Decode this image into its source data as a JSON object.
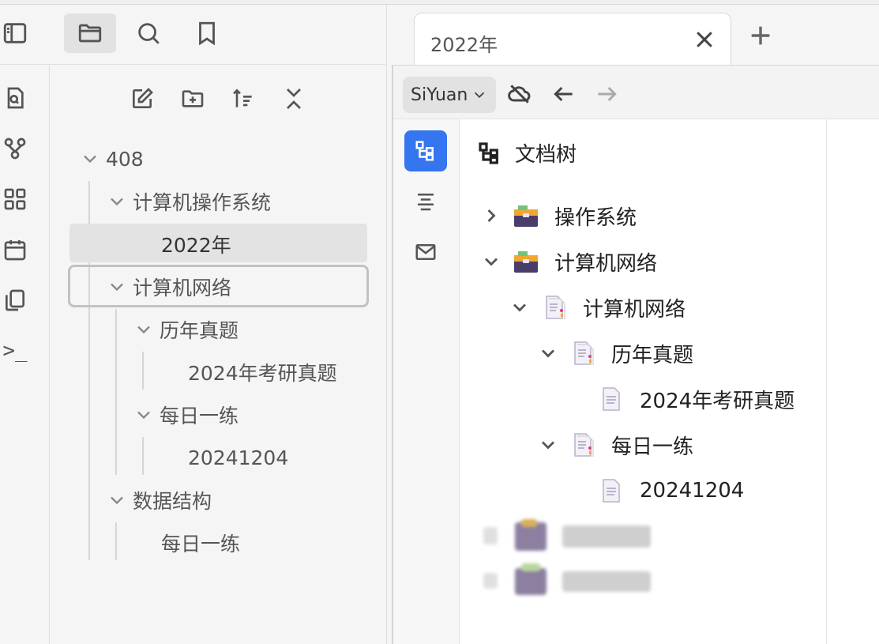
{
  "left_toolbar": {
    "icons": [
      "sidebar-toggle-icon",
      "folder-icon",
      "search-icon",
      "bookmark-icon"
    ]
  },
  "side_rail": {
    "icons": [
      "search-doc-icon",
      "graph-icon",
      "apps-icon",
      "calendar-icon",
      "copy-icon",
      "terminal-icon"
    ],
    "terminal_text": ">_"
  },
  "file_tree": {
    "tools": [
      "new-doc-icon",
      "new-folder-icon",
      "sort-icon",
      "collapse-all-icon"
    ],
    "rows": [
      {
        "label": "408"
      },
      {
        "label": "计算机操作系统"
      },
      {
        "label": "2022年"
      },
      {
        "label": "计算机网络"
      },
      {
        "label": "历年真题"
      },
      {
        "label": "2024年考研真题"
      },
      {
        "label": "每日一练"
      },
      {
        "label": "20241204"
      },
      {
        "label": "数据结构"
      },
      {
        "label": "每日一练"
      }
    ]
  },
  "tabs": [
    {
      "label": "2022年",
      "active": true
    }
  ],
  "content_toolbar": {
    "notebook_label": "SiYuan",
    "icons": [
      "cloud-off-icon",
      "arrow-left-icon",
      "arrow-right-icon"
    ]
  },
  "doc_tree": {
    "title": "文档树",
    "rows": [
      {
        "label": "操作系统"
      },
      {
        "label": "计算机网络"
      },
      {
        "label": "计算机网络"
      },
      {
        "label": "历年真题"
      },
      {
        "label": "2024年考研真题"
      },
      {
        "label": "每日一练"
      },
      {
        "label": "20241204"
      }
    ]
  },
  "colors": {
    "accent": "#3575f0",
    "selected_row": "#e3e3e3"
  }
}
